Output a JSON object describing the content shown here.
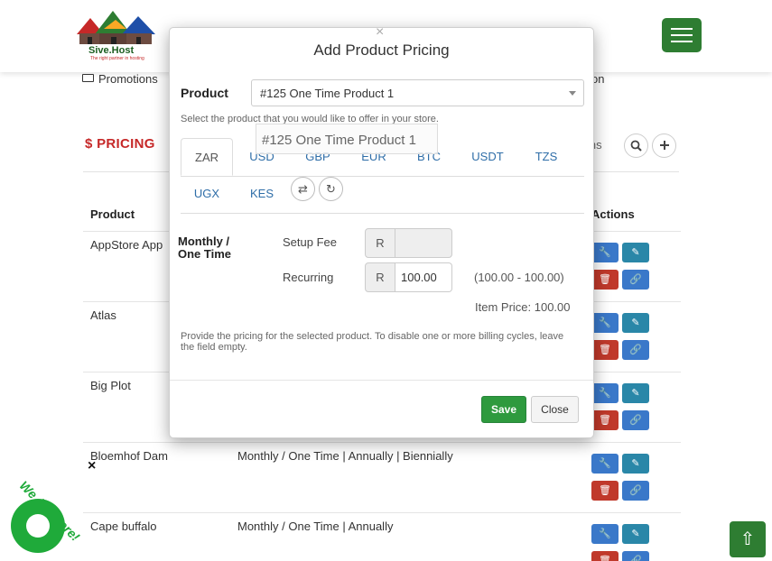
{
  "brand": {
    "name": "Sive.Host",
    "tagline": "The right partner in hosting"
  },
  "nav": {
    "promotions": "Promotions",
    "partial_right": "on"
  },
  "page": {
    "title": "$ PRICING",
    "partial_toolbar_text": "ins",
    "search_icon": "search-icon",
    "add_icon": "plus-icon"
  },
  "table": {
    "headers": {
      "product": "Product",
      "actions": "Actions"
    },
    "rows": [
      {
        "product": "AppStore App",
        "cycles": ""
      },
      {
        "product": "Atlas",
        "cycles": ""
      },
      {
        "product": "Big Plot",
        "cycles": ""
      },
      {
        "product": "Bloemhof Dam",
        "cycles": "Monthly / One Time | Annually | Biennially"
      },
      {
        "product": "Cape buffalo",
        "cycles": "Monthly / One Time | Annually"
      }
    ]
  },
  "modal": {
    "close_glyph": "×",
    "title": "Add Product Pricing",
    "product_label": "Product",
    "product_value": "#125 One Time Product 1",
    "product_help": "Select the product that you would like to offer in your store.",
    "drag_ghost": "#125 One Time Product 1",
    "tabs": [
      "ZAR",
      "USD",
      "GBP",
      "EUR",
      "BTC",
      "USDT",
      "TZS",
      "UGX",
      "KES"
    ],
    "active_tab": "ZAR",
    "cycle_label": "Monthly / One Time",
    "setup_fee_label": "Setup Fee",
    "recurring_label": "Recurring",
    "currency_prefix": "R",
    "setup_fee_value": "",
    "recurring_value": "100.00",
    "range_text": "(100.00 - 100.00)",
    "item_price_text": "Item Price: 100.00",
    "pricing_help": "Provide the pricing for the selected product. To disable one or more billing cycles, leave the field empty.",
    "save_label": "Save",
    "close_label": "Close"
  },
  "widgets": {
    "chat_text": "We Are Here!",
    "chat_close": "×"
  },
  "colors": {
    "primary_green": "#2e7d32",
    "title_red": "#c62828",
    "link_blue": "#2f6ea8"
  }
}
